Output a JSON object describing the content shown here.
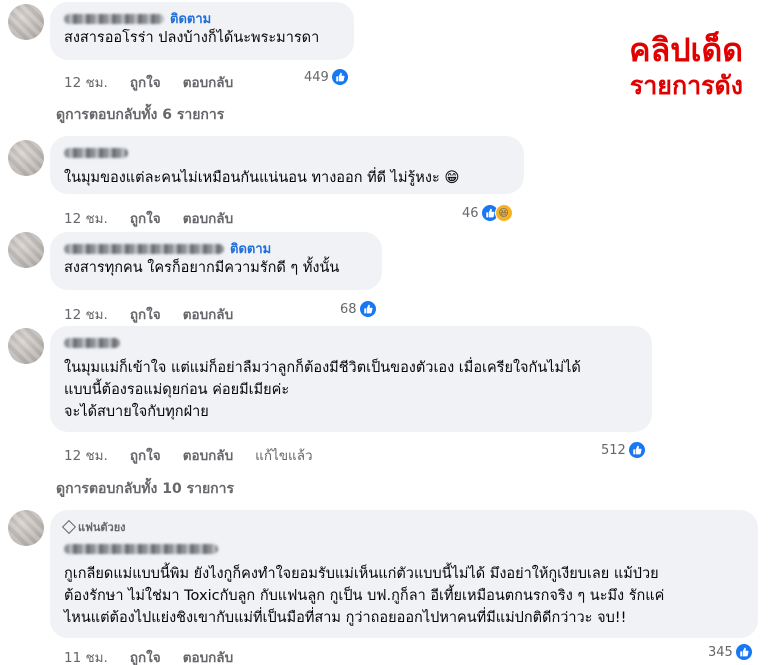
{
  "watermark": {
    "line1": "คลิปเด็ด",
    "line2": "รายการดัง"
  },
  "actions": {
    "like": "ถูกใจ",
    "reply": "ตอบกลับ",
    "edited": "แก้ไขแล้ว"
  },
  "comments": [
    {
      "follow": "ติดตาม",
      "text": "สงสารออโรร่า ปลงบ้างก็ได้นะพระมารดา",
      "time": "12 ชม.",
      "reaction_count": "449",
      "reactions": [
        "like-icon"
      ]
    },
    {
      "text": "ในมุมของแต่ละคนไม่เหมือนกันแน่นอน ทางออก ที่ดี ไม่รู้หงะ 😁",
      "time": "12 ชม.",
      "reaction_count": "46",
      "reactions": [
        "like-icon",
        "haha-icon"
      ]
    },
    {
      "follow": "ติดตาม",
      "text": "สงสารทุกคน ใครก็อยากมีความรักดี ๆ ทั้งนั้น",
      "time": "12 ชม.",
      "reaction_count": "68",
      "reactions": [
        "like-icon"
      ]
    },
    {
      "text_lines": [
        "ในมุมแม่ก็เข้าใจ แต่แม่ก็อย่าลืมว่าลูกก็ต้องมีชีวิตเป็นของตัวเอง เมื่อเครียใจกันไม่ได้",
        "แบบนี้ต้องรอแม่ดุยก่อน ค่อยมีเมียค่ะ",
        "จะได้สบายใจกับทุกฝ่าย"
      ],
      "time": "12 ชม.",
      "reaction_count": "512",
      "reactions": [
        "like-icon"
      ]
    },
    {
      "badge": "แฟนตัวยง",
      "text_lines": [
        "กูเกลียดแม่แบบนี้พิม ยังไงกูก็คงทำใจยอมรับแม่เห็นแก่ตัวแบบนี้ไม่ได้ มึงอย่าให้กูเงียบเลย แม้ป่วย",
        "ต้องรักษา ไม่ใช่มา Toxicกับลูก กับแฟนลูก กูเป็น บฟ.กูก็ลา อีเที้ยเหมือนตกนรกจริง ๆ นะมึง รักแค่",
        "ไหนแต่ต้องไปแย่งชิงเขากับแม่ที่เป็นมือที่สาม กูว่าถอยออกไปหาคนที่มีแม่ปกติดีกว่าวะ จบ!!"
      ],
      "time": "11 ชม.",
      "reaction_count": "345",
      "reactions": [
        "like-icon"
      ]
    }
  ],
  "view_replies": [
    "ดูการตอบกลับทั้ง 6 รายการ",
    "ดูการตอบกลับทั้ง 10 รายการ"
  ]
}
